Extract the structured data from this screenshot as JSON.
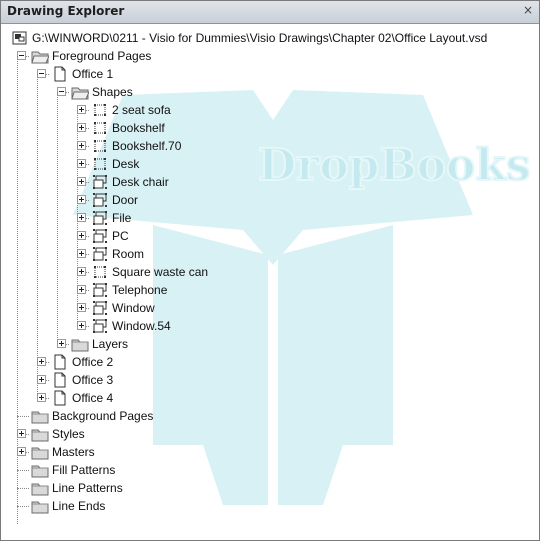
{
  "window": {
    "title": "Drawing Explorer",
    "close_glyph": "×"
  },
  "tree": [
    {
      "id": "root",
      "label": "G:\\WINWORD\\0211 - Visio for Dummies\\Visio Drawings\\Chapter 02\\Office Layout.vsd",
      "icon": "document-icon",
      "toggle": "none"
    },
    {
      "id": "fg",
      "label": "Foreground Pages",
      "icon": "folder-open-icon",
      "toggle": "minus"
    },
    {
      "id": "office1",
      "label": "Office 1",
      "icon": "page-icon",
      "toggle": "minus"
    },
    {
      "id": "shapes",
      "label": "Shapes",
      "icon": "folder-open-icon",
      "toggle": "minus"
    },
    {
      "id": "s1",
      "label": "2 seat sofa",
      "icon": "shape-icon",
      "toggle": "plus"
    },
    {
      "id": "s2",
      "label": "Bookshelf",
      "icon": "shape-icon",
      "toggle": "plus"
    },
    {
      "id": "s3",
      "label": "Bookshelf.70",
      "icon": "shape-icon",
      "toggle": "plus"
    },
    {
      "id": "s4",
      "label": "Desk",
      "icon": "shape-icon",
      "toggle": "plus"
    },
    {
      "id": "s5",
      "label": "Desk chair",
      "icon": "group-shape-icon",
      "toggle": "plus"
    },
    {
      "id": "s6",
      "label": "Door",
      "icon": "group-shape-icon",
      "toggle": "plus"
    },
    {
      "id": "s7",
      "label": "File",
      "icon": "group-shape-icon",
      "toggle": "plus"
    },
    {
      "id": "s8",
      "label": "PC",
      "icon": "group-shape-icon",
      "toggle": "plus"
    },
    {
      "id": "s9",
      "label": "Room",
      "icon": "group-shape-icon",
      "toggle": "plus"
    },
    {
      "id": "s10",
      "label": "Square waste can",
      "icon": "shape-icon",
      "toggle": "plus"
    },
    {
      "id": "s11",
      "label": "Telephone",
      "icon": "group-shape-icon",
      "toggle": "plus"
    },
    {
      "id": "s12",
      "label": "Window",
      "icon": "group-shape-icon",
      "toggle": "plus"
    },
    {
      "id": "s13",
      "label": "Window.54",
      "icon": "group-shape-icon",
      "toggle": "plus"
    },
    {
      "id": "layers",
      "label": "Layers",
      "icon": "folder-icon",
      "toggle": "plus"
    },
    {
      "id": "office2",
      "label": "Office 2",
      "icon": "page-icon",
      "toggle": "plus"
    },
    {
      "id": "office3",
      "label": "Office 3",
      "icon": "page-icon",
      "toggle": "plus"
    },
    {
      "id": "office4",
      "label": "Office 4",
      "icon": "page-icon",
      "toggle": "plus"
    },
    {
      "id": "bg",
      "label": "Background Pages",
      "icon": "folder-icon",
      "toggle": "none"
    },
    {
      "id": "styles",
      "label": "Styles",
      "icon": "folder-icon",
      "toggle": "plus"
    },
    {
      "id": "masters",
      "label": "Masters",
      "icon": "folder-icon",
      "toggle": "plus"
    },
    {
      "id": "fill",
      "label": "Fill Patterns",
      "icon": "folder-icon",
      "toggle": "none"
    },
    {
      "id": "linepat",
      "label": "Line Patterns",
      "icon": "folder-icon",
      "toggle": "none"
    },
    {
      "id": "lineends",
      "label": "Line Ends",
      "icon": "folder-icon",
      "toggle": "none"
    }
  ],
  "watermark": {
    "text": "DropBooks",
    "color": "#cfeef2"
  }
}
